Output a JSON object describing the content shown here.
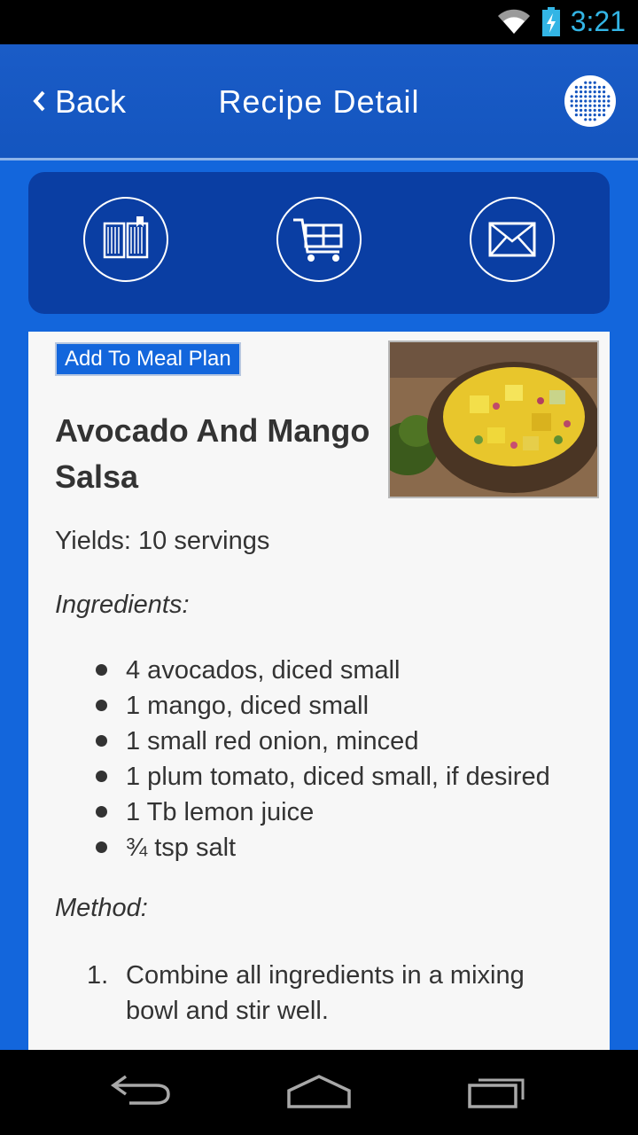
{
  "status_bar": {
    "time": "3:21",
    "wifi_icon": "wifi-icon",
    "battery_icon": "battery-charging-icon"
  },
  "app_bar": {
    "back_label": "Back",
    "title": "Recipe Detail",
    "menu_icon": "dotted-menu-icon"
  },
  "actions": [
    {
      "icon": "book-icon"
    },
    {
      "icon": "shopping-cart-icon"
    },
    {
      "icon": "mail-icon"
    }
  ],
  "recipe": {
    "add_to_meal_plan_label": "Add To Meal Plan",
    "title": "Avocado And Mango Salsa",
    "yields": "Yields: 10 servings",
    "ingredients_heading": "Ingredients:",
    "ingredients": [
      "4 avocados, diced small",
      "1 mango, diced small",
      "1 small red onion, minced",
      "1 plum tomato, diced small, if desired",
      "1 Tb lemon juice",
      "¾ tsp salt"
    ],
    "method_heading": "Method:",
    "method": [
      {
        "num": "1.",
        "text": "Combine all ingredients in a mixing bowl and stir well."
      }
    ]
  },
  "nav_bar": {
    "back_icon": "nav-back-icon",
    "home_icon": "nav-home-icon",
    "recents_icon": "nav-recents-icon"
  },
  "colors": {
    "app_bar": "#1a5cc7",
    "panel": "#0a3ea3",
    "background": "#1366dc",
    "card": "#f7f7f7",
    "clock": "#33b5e5"
  }
}
